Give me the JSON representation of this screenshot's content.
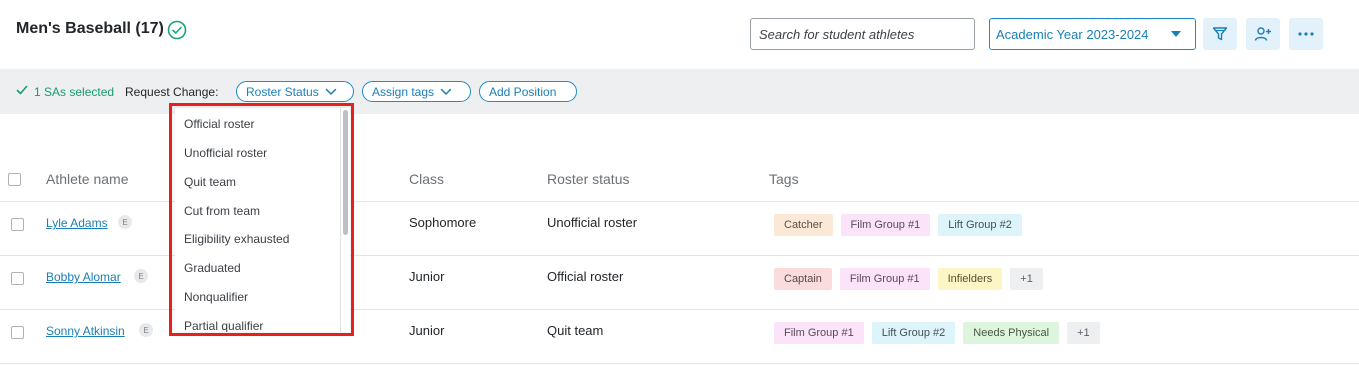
{
  "header": {
    "title": "Men's Baseball (17)",
    "search_placeholder": "Search for student athletes",
    "academic_year": "Academic Year 2023-2024"
  },
  "action_bar": {
    "selected_text": "1 SAs selected",
    "request_change_label": "Request Change:",
    "roster_status_label": "Roster Status",
    "assign_tags_label": "Assign tags",
    "add_position_label": "Add Position"
  },
  "dropdown": {
    "items": [
      "Official roster",
      "Unofficial roster",
      "Quit team",
      "Cut from team",
      "Eligibility exhausted",
      "Graduated",
      "Nonqualifier",
      "Partial qualifier"
    ]
  },
  "table": {
    "headers": {
      "athlete_name": "Athlete name",
      "class": "Class",
      "roster_status": "Roster status",
      "tags": "Tags"
    },
    "rows": [
      {
        "name": "Lyle Adams",
        "badge": "E",
        "class": "Sophomore",
        "roster_status": "Unofficial roster",
        "tags": [
          {
            "label": "Catcher",
            "bg": "#fbe8d6",
            "fg": "#5a5048"
          },
          {
            "label": "Film Group #1",
            "bg": "#fbe3fa",
            "fg": "#5a4a5a"
          },
          {
            "label": "Lift Group #2",
            "bg": "#ddf5fa",
            "fg": "#3f5257"
          }
        ]
      },
      {
        "name": "Bobby Alomar",
        "badge": "E",
        "class": "Junior",
        "roster_status": "Official roster",
        "tags": [
          {
            "label": "Captain",
            "bg": "#fbdcdc",
            "fg": "#5a4848"
          },
          {
            "label": "Film Group #1",
            "bg": "#fbe3fa",
            "fg": "#5a4a5a"
          },
          {
            "label": "Infielders",
            "bg": "#fcf6c6",
            "fg": "#55502f"
          },
          {
            "label": "+1",
            "bg": "#eeeff1",
            "fg": "#5a5f66"
          }
        ]
      },
      {
        "name": "Sonny Atkinsin",
        "badge": "E",
        "class": "Junior",
        "roster_status": "Quit team",
        "tags": [
          {
            "label": "Film Group #1",
            "bg": "#fbe3fa",
            "fg": "#5a4a5a"
          },
          {
            "label": "Lift Group #2",
            "bg": "#ddf5fa",
            "fg": "#3f5257"
          },
          {
            "label": "Needs Physical",
            "bg": "#dcf5dc",
            "fg": "#455645"
          },
          {
            "label": "+1",
            "bg": "#eeeff1",
            "fg": "#5a5f66"
          }
        ]
      }
    ]
  },
  "colors": {
    "accent": "#1a7fb5",
    "success": "#1a9a6f",
    "highlight": "#e8201c"
  }
}
